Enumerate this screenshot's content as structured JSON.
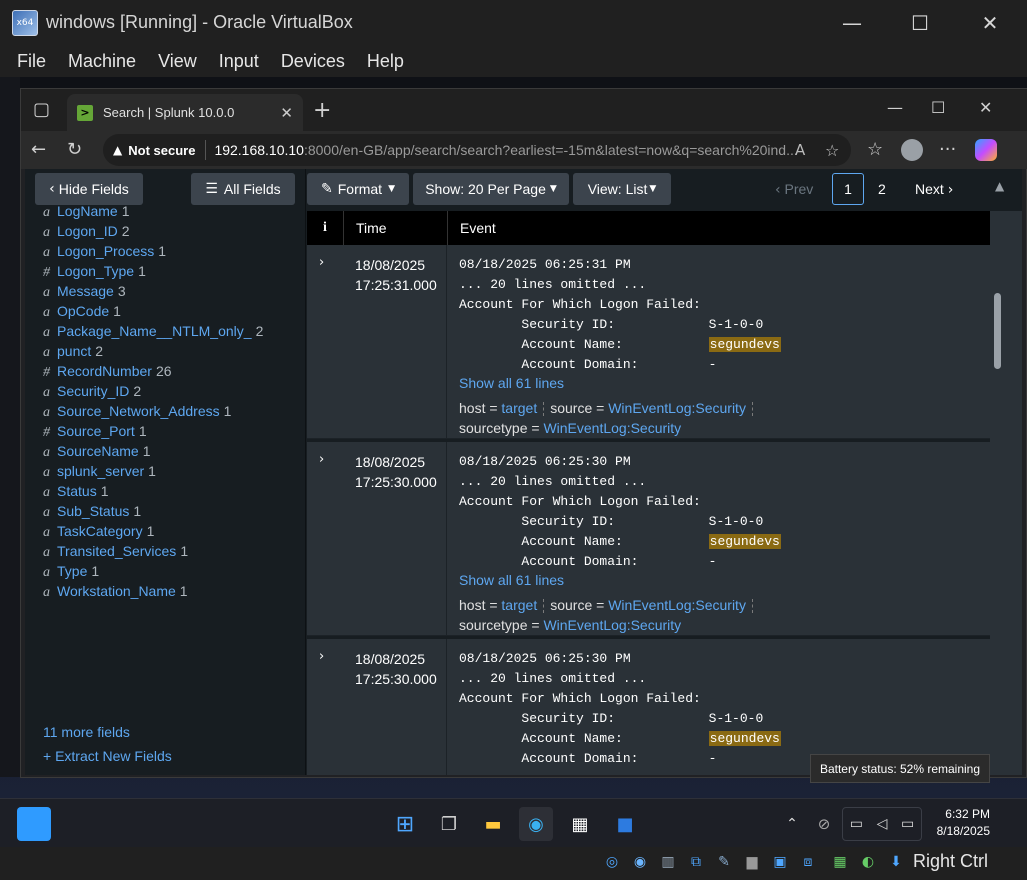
{
  "vbox": {
    "title": "windows [Running] - Oracle VirtualBox",
    "menu": [
      "File",
      "Machine",
      "View",
      "Input",
      "Devices",
      "Help"
    ],
    "host_key": "Right Ctrl",
    "icon_label": "x64"
  },
  "edge": {
    "tab_title": "Search | Splunk 10.0.0",
    "security_label": "Not secure",
    "url_host": "192.168.10.10",
    "url_path": ":8000/en-GB/app/search/search?earliest=-15m&latest=now&q=search%20ind..."
  },
  "splunk": {
    "hide_fields": "Hide Fields",
    "all_fields": "All Fields",
    "format": "Format",
    "per_page": "Show: 20 Per Page",
    "view": "View: List",
    "prev": "Prev",
    "pages": [
      "1",
      "2"
    ],
    "next": "Next",
    "columns": {
      "i": "i",
      "time": "Time",
      "event": "Event"
    },
    "fields": [
      {
        "type": "a",
        "name": "LogName",
        "count": "1"
      },
      {
        "type": "a",
        "name": "Logon_ID",
        "count": "2"
      },
      {
        "type": "a",
        "name": "Logon_Process",
        "count": "1"
      },
      {
        "type": "#",
        "name": "Logon_Type",
        "count": "1"
      },
      {
        "type": "a",
        "name": "Message",
        "count": "3"
      },
      {
        "type": "a",
        "name": "OpCode",
        "count": "1"
      },
      {
        "type": "a",
        "name": "Package_Name__NTLM_only_",
        "count": "2"
      },
      {
        "type": "a",
        "name": "punct",
        "count": "2"
      },
      {
        "type": "#",
        "name": "RecordNumber",
        "count": "26"
      },
      {
        "type": "a",
        "name": "Security_ID",
        "count": "2"
      },
      {
        "type": "a",
        "name": "Source_Network_Address",
        "count": "1"
      },
      {
        "type": "#",
        "name": "Source_Port",
        "count": "1"
      },
      {
        "type": "a",
        "name": "SourceName",
        "count": "1"
      },
      {
        "type": "a",
        "name": "splunk_server",
        "count": "1"
      },
      {
        "type": "a",
        "name": "Status",
        "count": "1"
      },
      {
        "type": "a",
        "name": "Sub_Status",
        "count": "1"
      },
      {
        "type": "a",
        "name": "TaskCategory",
        "count": "1"
      },
      {
        "type": "a",
        "name": "Transited_Services",
        "count": "1"
      },
      {
        "type": "a",
        "name": "Type",
        "count": "1"
      },
      {
        "type": "a",
        "name": "Workstation_Name",
        "count": "1"
      }
    ],
    "more_fields": "11 more fields",
    "extract_fields": "+ Extract New Fields",
    "events": [
      {
        "date": "18/08/2025",
        "time": "17:25:31.000",
        "line1": "08/18/2025 06:25:31 PM",
        "line2": "... 20 lines omitted ...",
        "line3": "Account For Which Logon Failed:",
        "line4": "        Security ID:            S-1-0-0",
        "line5a": "        Account Name:           ",
        "account": "segundevs",
        "line6": "        Account Domain:         -",
        "show_all": "Show all 61 lines",
        "host_label": "host = ",
        "host": "target",
        "source_label": "source = ",
        "source": "WinEventLog:Security",
        "st_label": "sourcetype = ",
        "sourcetype": "WinEventLog:Security"
      },
      {
        "date": "18/08/2025",
        "time": "17:25:30.000",
        "line1": "08/18/2025 06:25:30 PM",
        "line2": "... 20 lines omitted ...",
        "line3": "Account For Which Logon Failed:",
        "line4": "        Security ID:            S-1-0-0",
        "line5a": "        Account Name:           ",
        "account": "segundevs",
        "line6": "        Account Domain:         -",
        "show_all": "Show all 61 lines",
        "host_label": "host = ",
        "host": "target",
        "source_label": "source = ",
        "source": "WinEventLog:Security",
        "st_label": "sourcetype = ",
        "sourcetype": "WinEventLog:Security"
      },
      {
        "date": "18/08/2025",
        "time": "17:25:30.000",
        "line1": "08/18/2025 06:25:30 PM",
        "line2": "... 20 lines omitted ...",
        "line3": "Account For Which Logon Failed:",
        "line4": "        Security ID:            S-1-0-0",
        "line5a": "        Account Name:           ",
        "account": "segundevs",
        "line6": "        Account Domain:         -"
      }
    ]
  },
  "tooltip": "Battery status: 52% remaining",
  "taskbar": {
    "time": "6:32 PM",
    "date": "8/18/2025"
  }
}
